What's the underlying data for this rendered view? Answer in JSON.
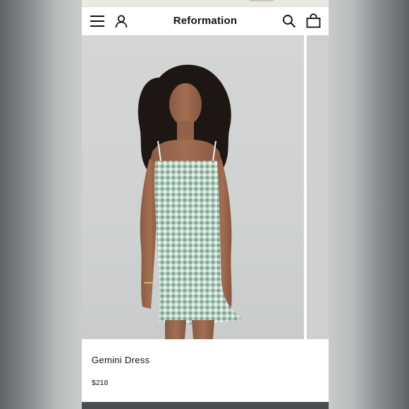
{
  "header": {
    "brand": "Reformation",
    "icons": [
      "menu-icon",
      "account-icon",
      "search-icon",
      "bag-icon"
    ]
  },
  "product": {
    "name": "Gemini Dress",
    "price": "$218",
    "image_alt_icon": "product-photo"
  },
  "colors": {
    "text": "#111111",
    "background": "#ffffff",
    "dress_green": "#8fb3a2"
  }
}
